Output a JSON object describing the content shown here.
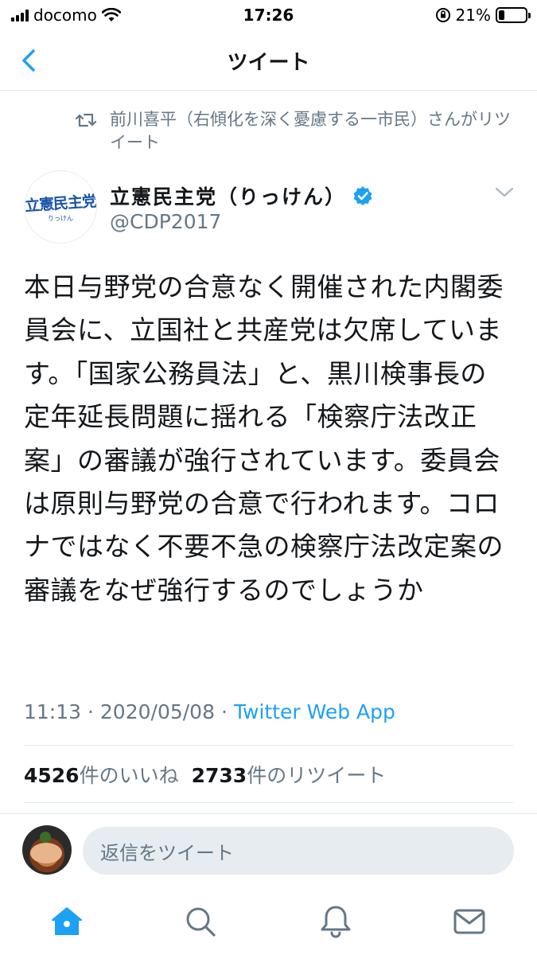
{
  "status_bar": {
    "carrier": "docomo",
    "time": "17:26",
    "battery": "21%"
  },
  "nav": {
    "title": "ツイート"
  },
  "retweet": {
    "text": "前川喜平（右傾化を深く憂慮する一市民）さんがリツイート"
  },
  "author": {
    "avatar_logo": "立憲民主党",
    "avatar_sub": "りっけん",
    "name": "立憲民主党（りっけん）",
    "handle": "@CDP2017",
    "verified": true
  },
  "tweet": {
    "text": "本日与野党の合意なく開催された内閣委員会に、立国社と共産党は欠席しています。「国家公務員法」と、黒川検事長の定年延長問題に揺れる「検察庁法改正案」の審議が強行されています。委員会は原則与野党の合意で行われます。コロナではなく不要不急の検察庁法改定案の審議をなぜ強行するのでしょうか",
    "time": "11:13",
    "date": "2020/05/08",
    "separator": "·",
    "app": "Twitter Web App"
  },
  "stats": {
    "likes_count": "4526",
    "likes_label": "件のいいね",
    "retweets_count": "2733",
    "retweets_label": "件のリツイート"
  },
  "reply": {
    "placeholder": "返信をツイート"
  },
  "tabs": [
    {
      "name": "home-icon",
      "active": true
    },
    {
      "name": "search-icon",
      "active": false
    },
    {
      "name": "notifications-icon",
      "active": false
    },
    {
      "name": "messages-icon",
      "active": false
    }
  ],
  "colors": {
    "accent": "#1da1f2",
    "secondary_text": "#657786",
    "primary_text": "#14171a"
  }
}
